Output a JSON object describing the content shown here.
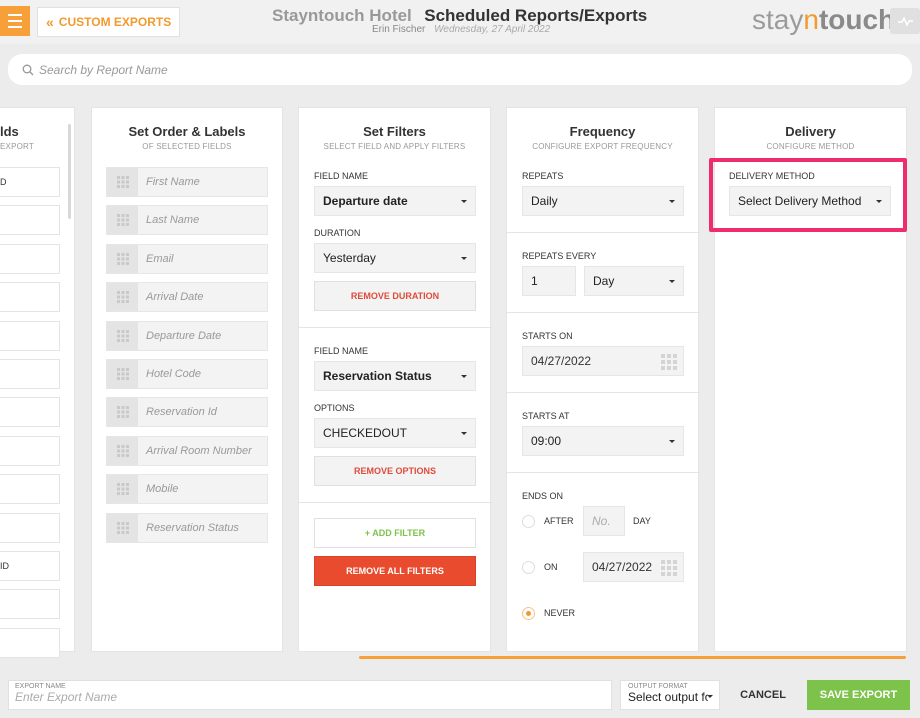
{
  "header": {
    "menu_icon": "hamburger-icon",
    "back_label": "CUSTOM EXPORTS",
    "hotel": "Stayntouch Hotel",
    "title": "Scheduled Reports/Exports",
    "user": "Erin Fischer",
    "date": "Wednesday, 27 April 2022",
    "logo_a": "stay",
    "logo_n": "n",
    "logo_b": "touch"
  },
  "search": {
    "placeholder": "Search by Report Name"
  },
  "fields_col": {
    "title": "lds",
    "subtitle": "EXPORT",
    "rows": [
      "D",
      "",
      "",
      "",
      "",
      "",
      "",
      "",
      "",
      "",
      "ID",
      "",
      ""
    ]
  },
  "order_col": {
    "title": "Set Order & Labels",
    "subtitle": "OF SELECTED FIELDS",
    "fields": [
      "First Name",
      "Last Name",
      "Email",
      "Arrival Date",
      "Departure Date",
      "Hotel Code",
      "Reservation Id",
      "Arrival Room Number",
      "Mobile",
      "Reservation Status"
    ]
  },
  "filters_col": {
    "title": "Set Filters",
    "subtitle": "SELECT FIELD AND APPLY FILTERS",
    "field_name_label_1": "FIELD NAME",
    "field_value_1": "Departure date",
    "duration_label": "DURATION",
    "duration_value": "Yesterday",
    "remove_duration": "REMOVE DURATION",
    "field_name_label_2": "FIELD NAME",
    "field_value_2": "Reservation Status",
    "options_label": "OPTIONS",
    "options_value": "CHECKEDOUT",
    "remove_options": "REMOVE OPTIONS",
    "add_filter": "+ ADD FILTER",
    "remove_all": "REMOVE ALL FILTERS"
  },
  "frequency_col": {
    "title": "Frequency",
    "subtitle": "CONFIGURE EXPORT FREQUENCY",
    "repeats_label": "REPEATS",
    "repeats_value": "Daily",
    "repeats_every_label": "REPEATS EVERY",
    "repeats_every_num": "1",
    "repeats_every_unit": "Day",
    "starts_on_label": "STARTS ON",
    "starts_on_value": "04/27/2022",
    "starts_at_label": "STARTS AT",
    "starts_at_value": "09:00",
    "ends_on_label": "ENDS ON",
    "after_label": "AFTER",
    "after_placeholder": "No.",
    "day_label": "DAY",
    "on_label": "ON",
    "on_value": "04/27/2022",
    "never_label": "NEVER"
  },
  "delivery_col": {
    "title": "Delivery",
    "subtitle": "CONFIGURE METHOD",
    "method_label": "DELIVERY METHOD",
    "method_value": "Select Delivery Method"
  },
  "bottom": {
    "export_name_label": "EXPORT NAME",
    "export_name_placeholder": "Enter Export Name",
    "output_format_label": "OUTPUT FORMAT",
    "output_format_value": "Select output format",
    "cancel": "CANCEL",
    "save": "SAVE EXPORT"
  },
  "colors": {
    "accent": "#f29a2e",
    "danger": "#e04b3a",
    "success": "#7dc24a",
    "highlight": "#ee2c6e"
  }
}
